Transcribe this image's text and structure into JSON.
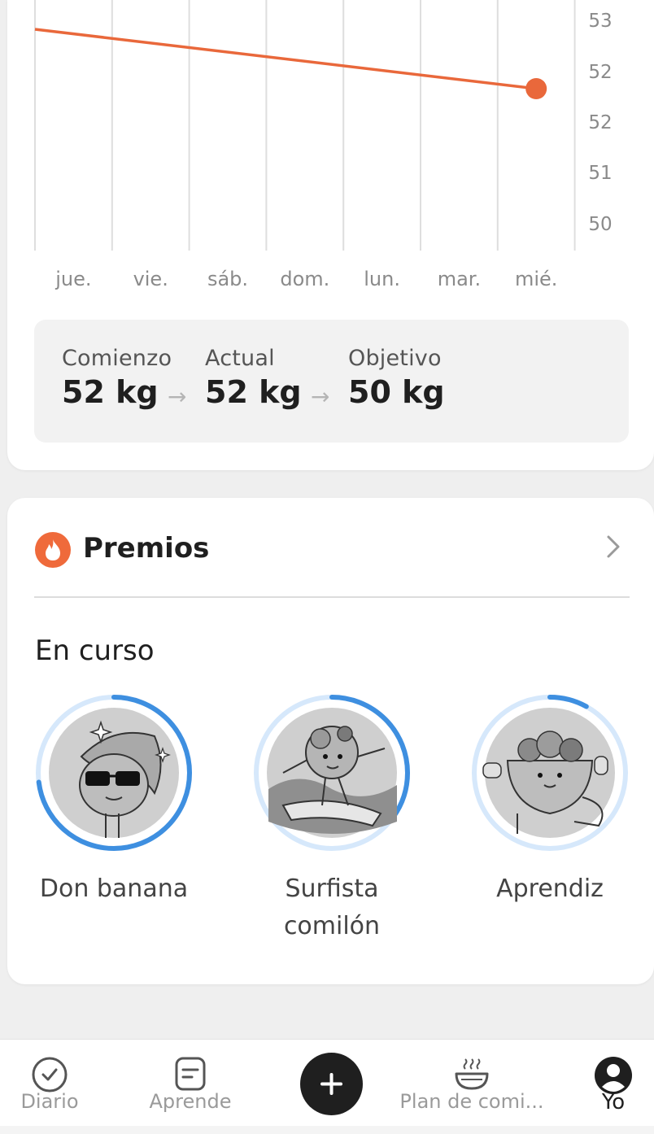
{
  "chart_data": {
    "type": "line",
    "categories": [
      "jue.",
      "vie.",
      "sáb.",
      "dom.",
      "lun.",
      "mar.",
      "mié."
    ],
    "y_tick_labels": [
      "53",
      "52",
      "52",
      "51",
      "50"
    ],
    "series": [
      {
        "points": [
          {
            "x": "jue.",
            "y": 52.8
          },
          {
            "x": "mié.",
            "y": 51.7
          }
        ]
      }
    ],
    "line_color": "#e9683b",
    "grid": "vertical",
    "y_axis_side": "right"
  },
  "summary": {
    "start_label": "Comienzo",
    "start_value": "52 kg",
    "current_label": "Actual",
    "current_value": "52 kg",
    "goal_label": "Objetivo",
    "goal_value": "50 kg"
  },
  "awards": {
    "title": "Premios",
    "icon": "fire-icon",
    "section_label": "En curso",
    "items": [
      {
        "name": "Don banana",
        "progress": 0.73
      },
      {
        "name": "Surfista comilón",
        "progress": 0.35
      },
      {
        "name": "Aprendiz",
        "progress": 0.08
      }
    ]
  },
  "nav": {
    "items": [
      {
        "label": "Diario",
        "icon": "check-circle-icon"
      },
      {
        "label": "Aprende",
        "icon": "note-icon"
      },
      {
        "label": "",
        "icon": "plus-icon"
      },
      {
        "label": "Plan de comi...",
        "icon": "bowl-icon"
      },
      {
        "label": "Yo",
        "icon": "user-icon",
        "active": true
      }
    ]
  },
  "colors": {
    "accent": "#e9683b",
    "progress": "#3e8fe0",
    "progress_track": "#d6e8fb"
  }
}
